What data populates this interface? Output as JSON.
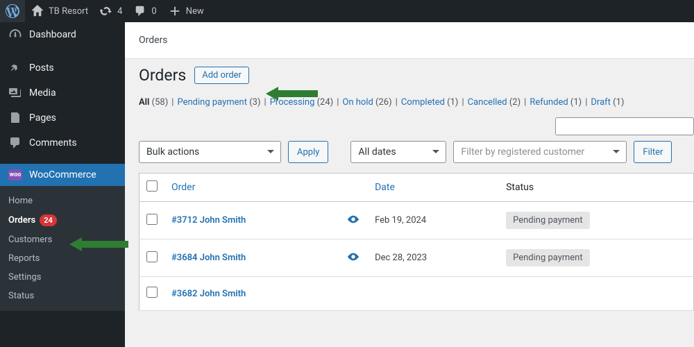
{
  "adminBar": {
    "siteName": "TB Resort",
    "updates": "4",
    "comments": "0",
    "new": "New"
  },
  "sidebar": {
    "items": [
      {
        "label": "Dashboard"
      },
      {
        "label": "Posts"
      },
      {
        "label": "Media"
      },
      {
        "label": "Pages"
      },
      {
        "label": "Comments"
      },
      {
        "label": "WooCommerce"
      }
    ],
    "submenu": [
      {
        "label": "Home"
      },
      {
        "label": "Orders",
        "badge": "24"
      },
      {
        "label": "Customers"
      },
      {
        "label": "Reports"
      },
      {
        "label": "Settings"
      },
      {
        "label": "Status"
      }
    ]
  },
  "breadcrumb": "Orders",
  "page": {
    "title": "Orders",
    "addBtn": "Add order"
  },
  "filters": [
    {
      "label": "All",
      "count": "(58)",
      "current": true
    },
    {
      "label": "Pending payment",
      "count": "(3)"
    },
    {
      "label": "Processing",
      "count": "(24)"
    },
    {
      "label": "On hold",
      "count": "(26)"
    },
    {
      "label": "Completed",
      "count": "(1)"
    },
    {
      "label": "Cancelled",
      "count": "(2)"
    },
    {
      "label": "Refunded",
      "count": "(1)"
    },
    {
      "label": "Draft",
      "count": "(1)"
    }
  ],
  "actions": {
    "bulk": "Bulk actions",
    "apply": "Apply",
    "dates": "All dates",
    "customerFilter": "Filter by registered customer",
    "filter": "Filter"
  },
  "table": {
    "headers": {
      "order": "Order",
      "date": "Date",
      "status": "Status"
    },
    "rows": [
      {
        "order": "#3712 John Smith",
        "date": "Feb 19, 2024",
        "status": "Pending payment"
      },
      {
        "order": "#3684 John Smith",
        "date": "Dec 28, 2023",
        "status": "Pending payment"
      },
      {
        "order": "#3682 John Smith",
        "date": "",
        "status": ""
      }
    ]
  }
}
